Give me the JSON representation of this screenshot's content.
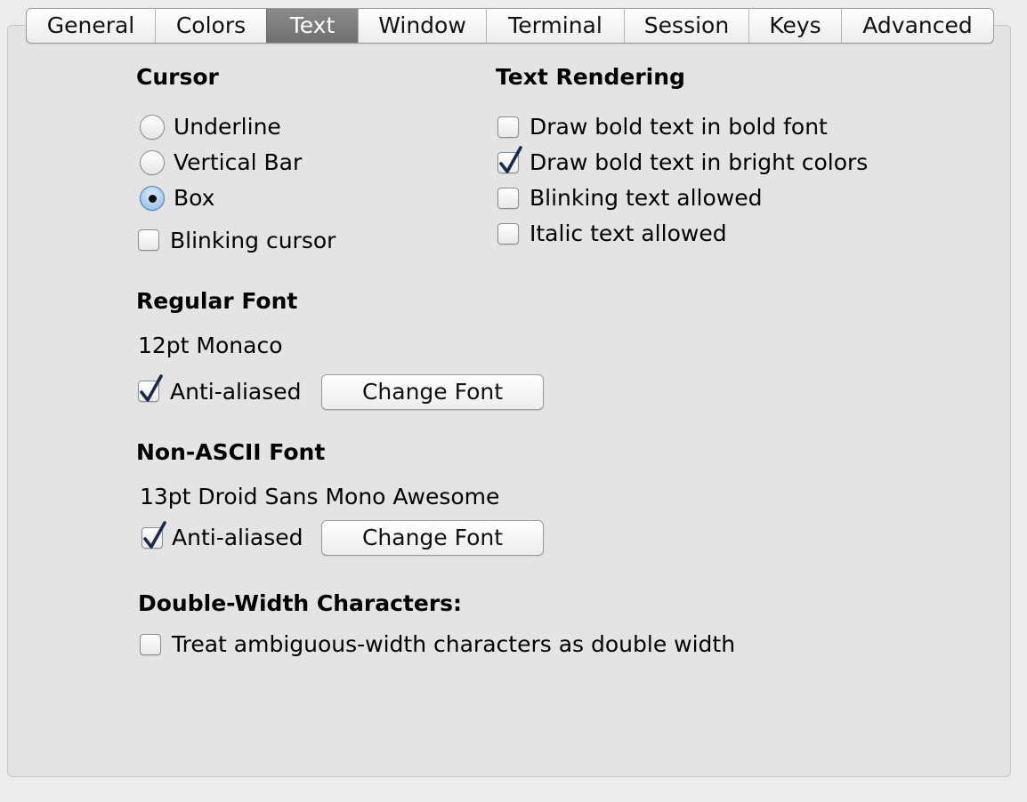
{
  "tabs": [
    {
      "label": "General",
      "active": false
    },
    {
      "label": "Colors",
      "active": false
    },
    {
      "label": "Text",
      "active": true
    },
    {
      "label": "Window",
      "active": false
    },
    {
      "label": "Terminal",
      "active": false
    },
    {
      "label": "Session",
      "active": false
    },
    {
      "label": "Keys",
      "active": false
    },
    {
      "label": "Advanced",
      "active": false
    }
  ],
  "cursor": {
    "heading": "Cursor",
    "options": [
      {
        "label": "Underline",
        "selected": false
      },
      {
        "label": "Vertical Bar",
        "selected": false
      },
      {
        "label": "Box",
        "selected": true
      }
    ],
    "blinking": {
      "label": "Blinking cursor",
      "checked": false
    }
  },
  "text_rendering": {
    "heading": "Text Rendering",
    "options": [
      {
        "label": "Draw bold text in bold font",
        "checked": false
      },
      {
        "label": "Draw bold text in bright colors",
        "checked": true
      },
      {
        "label": "Blinking text allowed",
        "checked": false
      },
      {
        "label": "Italic text allowed",
        "checked": false
      }
    ]
  },
  "regular_font": {
    "heading": "Regular Font",
    "value": "12pt Monaco",
    "antialiased": {
      "label": "Anti-aliased",
      "checked": true
    },
    "change_button": "Change Font"
  },
  "nonascii_font": {
    "heading": "Non-ASCII Font",
    "value": "13pt Droid Sans Mono Awesome",
    "antialiased": {
      "label": "Anti-aliased",
      "checked": true
    },
    "change_button": "Change Font"
  },
  "double_width": {
    "heading": "Double-Width Characters:",
    "option": {
      "label": "Treat ambiguous-width characters as double width",
      "checked": false
    }
  }
}
